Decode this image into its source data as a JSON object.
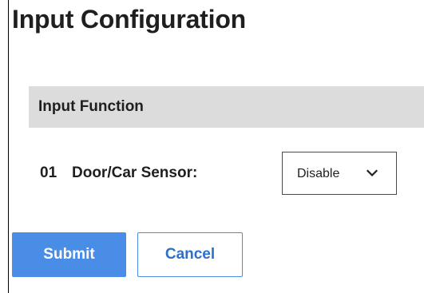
{
  "page": {
    "title": "Input Configuration"
  },
  "section": {
    "header": "Input Function"
  },
  "inputs": [
    {
      "number": "01",
      "label": "Door/Car Sensor:",
      "selected_value": "Disable"
    }
  ],
  "actions": {
    "submit_label": "Submit",
    "cancel_label": "Cancel"
  },
  "icons": {
    "select_arrow": "chevron-down-icon"
  },
  "colors": {
    "primary": "#4a8de6",
    "section_bg": "#dcdcdc",
    "cancel_text": "#2e6fc7"
  }
}
